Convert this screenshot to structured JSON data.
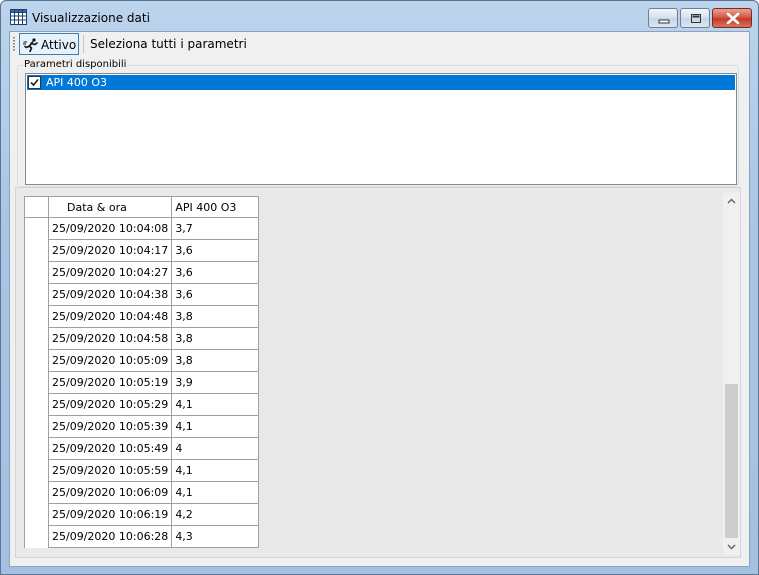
{
  "window": {
    "title": "Visualizzazione dati",
    "icons": {
      "app": "table-grid-icon",
      "minimize": "minimize-icon",
      "maximize": "maximize-icon",
      "close": "close-icon"
    }
  },
  "toolbar": {
    "active_button": {
      "label": "Attivo",
      "icon": "running-person-icon"
    },
    "select_all_label": "Seleziona tutti i parametri"
  },
  "parameters": {
    "group_label": "Parametri disponibili",
    "items": [
      {
        "label": "API 400 O3",
        "checked": true,
        "selected": true
      }
    ]
  },
  "grid": {
    "columns": [
      "Data & ora",
      "API 400 O3"
    ],
    "rows": [
      {
        "datetime": "25/09/2020 10:04:08",
        "value": "3,7"
      },
      {
        "datetime": "25/09/2020 10:04:17",
        "value": "3,6"
      },
      {
        "datetime": "25/09/2020 10:04:27",
        "value": "3,6"
      },
      {
        "datetime": "25/09/2020 10:04:38",
        "value": "3,6"
      },
      {
        "datetime": "25/09/2020 10:04:48",
        "value": "3,8"
      },
      {
        "datetime": "25/09/2020 10:04:58",
        "value": "3,8"
      },
      {
        "datetime": "25/09/2020 10:05:09",
        "value": "3,8"
      },
      {
        "datetime": "25/09/2020 10:05:19",
        "value": "3,9"
      },
      {
        "datetime": "25/09/2020 10:05:29",
        "value": "4,1"
      },
      {
        "datetime": "25/09/2020 10:05:39",
        "value": "4,1"
      },
      {
        "datetime": "25/09/2020 10:05:49",
        "value": "4"
      },
      {
        "datetime": "25/09/2020 10:05:59",
        "value": "4,1"
      },
      {
        "datetime": "25/09/2020 10:06:09",
        "value": "4,1"
      },
      {
        "datetime": "25/09/2020 10:06:19",
        "value": "4,2"
      },
      {
        "datetime": "25/09/2020 10:06:28",
        "value": "4,3"
      }
    ]
  },
  "colors": {
    "selection": "#0078d7",
    "titlebar": "#a9c5e6",
    "close_button": "#c43c28"
  }
}
